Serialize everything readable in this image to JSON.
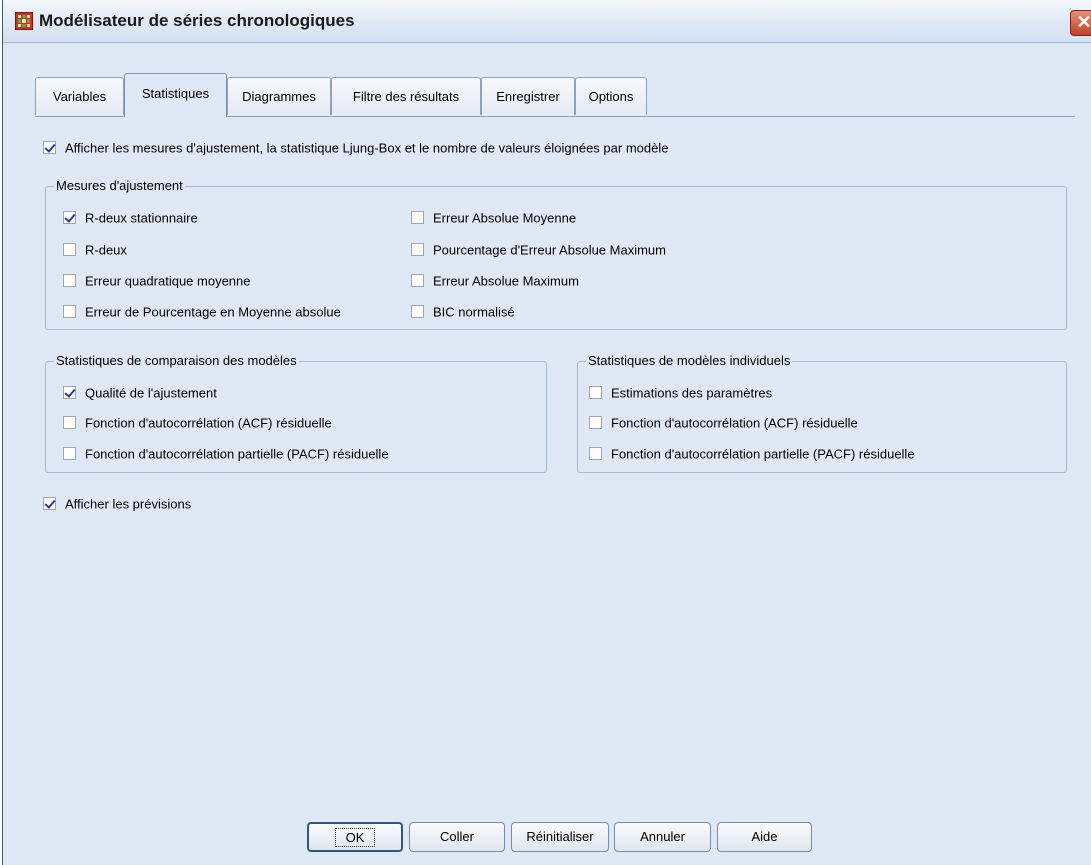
{
  "window": {
    "title": "Modélisateur de séries chronologiques",
    "close_symbol": "✕"
  },
  "tabs": [
    {
      "label": "Variables"
    },
    {
      "label": "Statistiques"
    },
    {
      "label": "Diagrammes"
    },
    {
      "label": "Filtre des résultats"
    },
    {
      "label": "Enregistrer"
    },
    {
      "label": "Options"
    }
  ],
  "active_tab": "Statistiques",
  "main": {
    "display_fit": {
      "label": "Afficher les mesures d'ajustement, la statistique Ljung-Box et le nombre de valeurs éloignées par modèle",
      "checked": true
    },
    "show_forecasts": {
      "label": "Afficher les prévisions",
      "checked": true
    }
  },
  "fit_measures": {
    "legend": "Mesures d'ajustement",
    "left": [
      {
        "label": "R-deux stationnaire",
        "checked": true
      },
      {
        "label": "R-deux",
        "checked": false
      },
      {
        "label": "Erreur quadratique moyenne",
        "checked": false
      },
      {
        "label": "Erreur de Pourcentage en Moyenne absolue",
        "checked": false
      }
    ],
    "right": [
      {
        "label": "Erreur Absolue Moyenne",
        "checked": false
      },
      {
        "label": "Pourcentage d'Erreur Absolue Maximum",
        "checked": false
      },
      {
        "label": "Erreur Absolue Maximum",
        "checked": false
      },
      {
        "label": "BIC normalisé",
        "checked": false
      }
    ]
  },
  "comparison": {
    "legend": "Statistiques de comparaison des modèles",
    "items": [
      {
        "label": "Qualité de l'ajustement",
        "checked": true
      },
      {
        "label": "Fonction d'autocorrélation (ACF) résiduelle",
        "checked": false
      },
      {
        "label": "Fonction d'autocorrélation partielle (PACF) résiduelle",
        "checked": false
      }
    ]
  },
  "individual": {
    "legend": "Statistiques de modèles individuels",
    "items": [
      {
        "label": "Estimations des paramètres",
        "checked": false
      },
      {
        "label": "Fonction d'autocorrélation (ACF) résiduelle",
        "checked": false
      },
      {
        "label": "Fonction d'autocorrélation partielle (PACF) résiduelle",
        "checked": false
      }
    ]
  },
  "buttons": {
    "ok": "OK",
    "paste": "Coller",
    "reset": "Réinitialiser",
    "cancel": "Annuler",
    "help": "Aide"
  }
}
